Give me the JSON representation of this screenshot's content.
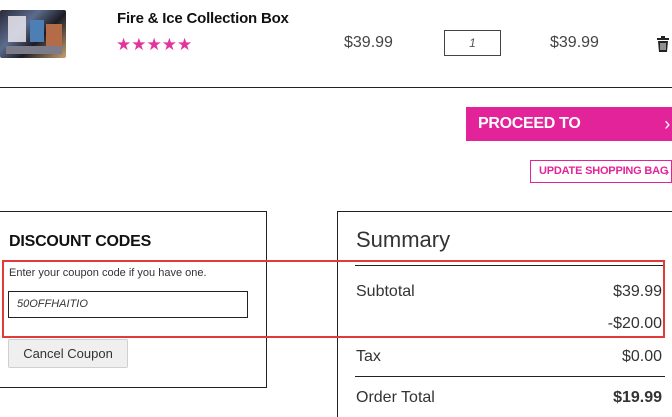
{
  "product": {
    "name": "Fire & Ice Collection Box",
    "rating_stars": "★★★★★",
    "rating": 5,
    "price": "$39.99",
    "quantity": "1",
    "total": "$39.99"
  },
  "actions": {
    "checkout_label": "PROCEED TO CHECKOUT",
    "checkout_chevron": "›",
    "update_label": "UPDATE SHOPPING BAG",
    "update_chevron": "›"
  },
  "discount": {
    "title": "DISCOUNT CODES",
    "label": "Enter your coupon code if you have one.",
    "code": "50OFFHAITIO",
    "cancel_label": "Cancel Coupon"
  },
  "summary": {
    "title": "Summary",
    "subtotal_label": "Subtotal",
    "subtotal_value": "$39.99",
    "discount_value": "-$20.00",
    "tax_label": "Tax",
    "tax_value": "$0.00",
    "total_label": "Order Total",
    "total_value": "$19.99"
  },
  "colors": {
    "brand_pink": "#e3239a",
    "highlight_red": "#e03a3a"
  }
}
